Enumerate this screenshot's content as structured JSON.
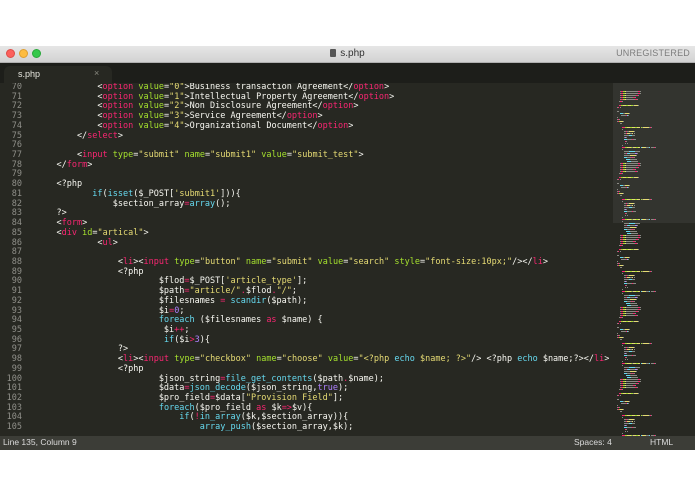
{
  "window": {
    "title": "s.php",
    "registration": "UNREGISTERED"
  },
  "tabs": [
    {
      "label": "s.php",
      "close_glyph": "×"
    }
  ],
  "line_numbers": [
    "70",
    "71",
    "72",
    "73",
    "74",
    "75",
    "76",
    "77",
    "78",
    "79",
    "80",
    "81",
    "82",
    "83",
    "84",
    "85",
    "86",
    "87",
    "88",
    "89",
    "90",
    "91",
    "92",
    "93",
    "94",
    "95",
    "96",
    "97",
    "98",
    "99",
    "100",
    "101",
    "102",
    "103",
    "104",
    "105"
  ],
  "code_lines": [
    [
      [
        "plain",
        "            <"
      ],
      [
        "tag",
        "option"
      ],
      [
        "plain",
        " "
      ],
      [
        "attr",
        "value"
      ],
      [
        "plain",
        "="
      ],
      [
        "str",
        "\"0\""
      ],
      [
        "plain",
        ">Business transaction Agreement</"
      ],
      [
        "tag",
        "option"
      ],
      [
        "plain",
        ">"
      ]
    ],
    [
      [
        "plain",
        "            <"
      ],
      [
        "tag",
        "option"
      ],
      [
        "plain",
        " "
      ],
      [
        "attr",
        "value"
      ],
      [
        "plain",
        "="
      ],
      [
        "str",
        "\"1\""
      ],
      [
        "plain",
        ">Intellectual Property Agreement</"
      ],
      [
        "tag",
        "option"
      ],
      [
        "plain",
        ">"
      ]
    ],
    [
      [
        "plain",
        "            <"
      ],
      [
        "tag",
        "option"
      ],
      [
        "plain",
        " "
      ],
      [
        "attr",
        "value"
      ],
      [
        "plain",
        "="
      ],
      [
        "str",
        "\"2\""
      ],
      [
        "plain",
        ">Non Disclosure Agreement</"
      ],
      [
        "tag",
        "option"
      ],
      [
        "plain",
        ">"
      ]
    ],
    [
      [
        "plain",
        "            <"
      ],
      [
        "tag",
        "option"
      ],
      [
        "plain",
        " "
      ],
      [
        "attr",
        "value"
      ],
      [
        "plain",
        "="
      ],
      [
        "str",
        "\"3\""
      ],
      [
        "plain",
        ">Service Agreement</"
      ],
      [
        "tag",
        "option"
      ],
      [
        "plain",
        ">"
      ]
    ],
    [
      [
        "plain",
        "            <"
      ],
      [
        "tag",
        "option"
      ],
      [
        "plain",
        " "
      ],
      [
        "attr",
        "value"
      ],
      [
        "plain",
        "="
      ],
      [
        "str",
        "\"4\""
      ],
      [
        "plain",
        ">Organizational Document</"
      ],
      [
        "tag",
        "option"
      ],
      [
        "plain",
        ">"
      ]
    ],
    [
      [
        "plain",
        "        </"
      ],
      [
        "tag",
        "select"
      ],
      [
        "plain",
        ">"
      ]
    ],
    [
      [
        "plain",
        ""
      ]
    ],
    [
      [
        "plain",
        "        <"
      ],
      [
        "tag",
        "input"
      ],
      [
        "plain",
        " "
      ],
      [
        "attr",
        "type"
      ],
      [
        "plain",
        "="
      ],
      [
        "str",
        "\"submit\""
      ],
      [
        "plain",
        " "
      ],
      [
        "attr",
        "name"
      ],
      [
        "plain",
        "="
      ],
      [
        "str",
        "\"submit1\""
      ],
      [
        "plain",
        " "
      ],
      [
        "attr",
        "value"
      ],
      [
        "plain",
        "="
      ],
      [
        "str",
        "\"submit_test\""
      ],
      [
        "plain",
        ">"
      ]
    ],
    [
      [
        "plain",
        "    </"
      ],
      [
        "tag",
        "form"
      ],
      [
        "plain",
        ">"
      ]
    ],
    [
      [
        "plain",
        ""
      ]
    ],
    [
      [
        "plain",
        "    <?php"
      ]
    ],
    [
      [
        "plain",
        "           "
      ],
      [
        "fn",
        "if"
      ],
      [
        "plain",
        "("
      ],
      [
        "fn",
        "isset"
      ],
      [
        "plain",
        "($_POST["
      ],
      [
        "str",
        "'submit1'"
      ],
      [
        "plain",
        "])){"
      ]
    ],
    [
      [
        "plain",
        "               $section_array"
      ],
      [
        "op",
        "="
      ],
      [
        "fn",
        "array"
      ],
      [
        "plain",
        "();"
      ]
    ],
    [
      [
        "plain",
        "    ?>"
      ]
    ],
    [
      [
        "plain",
        "    <"
      ],
      [
        "tag",
        "form"
      ],
      [
        "plain",
        ">"
      ]
    ],
    [
      [
        "plain",
        "    <"
      ],
      [
        "tag",
        "div"
      ],
      [
        "plain",
        " "
      ],
      [
        "attr",
        "id"
      ],
      [
        "plain",
        "="
      ],
      [
        "str",
        "\"artical\""
      ],
      [
        "plain",
        ">"
      ]
    ],
    [
      [
        "plain",
        "            <"
      ],
      [
        "tag",
        "ul"
      ],
      [
        "plain",
        ">"
      ]
    ],
    [
      [
        "plain",
        ""
      ]
    ],
    [
      [
        "plain",
        "                <"
      ],
      [
        "tag",
        "li"
      ],
      [
        "plain",
        "><"
      ],
      [
        "tag",
        "input"
      ],
      [
        "plain",
        " "
      ],
      [
        "attr",
        "type"
      ],
      [
        "plain",
        "="
      ],
      [
        "str",
        "\"button\""
      ],
      [
        "plain",
        " "
      ],
      [
        "attr",
        "name"
      ],
      [
        "plain",
        "="
      ],
      [
        "str",
        "\"submit\""
      ],
      [
        "plain",
        " "
      ],
      [
        "attr",
        "value"
      ],
      [
        "plain",
        "="
      ],
      [
        "str",
        "\"search\""
      ],
      [
        "plain",
        " "
      ],
      [
        "attr",
        "style"
      ],
      [
        "plain",
        "="
      ],
      [
        "str",
        "\"font-size:10px;\""
      ],
      [
        "plain",
        "/></"
      ],
      [
        "tag",
        "li"
      ],
      [
        "plain",
        ">"
      ]
    ],
    [
      [
        "plain",
        "                <?php"
      ]
    ],
    [
      [
        "plain",
        "                        $flod"
      ],
      [
        "op",
        "="
      ],
      [
        "plain",
        "$_POST["
      ],
      [
        "str",
        "'article_type'"
      ],
      [
        "plain",
        "];"
      ]
    ],
    [
      [
        "plain",
        "                        $path"
      ],
      [
        "op",
        "="
      ],
      [
        "str",
        "\"article/\""
      ],
      [
        "op",
        "."
      ],
      [
        "plain",
        "$flod"
      ],
      [
        "op",
        "."
      ],
      [
        "str",
        "\"/\""
      ],
      [
        "plain",
        ";"
      ]
    ],
    [
      [
        "plain",
        "                        $filesnames "
      ],
      [
        "op",
        "="
      ],
      [
        "plain",
        " "
      ],
      [
        "fn",
        "scandir"
      ],
      [
        "plain",
        "($path);"
      ]
    ],
    [
      [
        "plain",
        "                        $i"
      ],
      [
        "op",
        "="
      ],
      [
        "num",
        "0"
      ],
      [
        "plain",
        ";"
      ]
    ],
    [
      [
        "plain",
        "                        "
      ],
      [
        "fn",
        "foreach"
      ],
      [
        "plain",
        " ($filesnames "
      ],
      [
        "op",
        "as"
      ],
      [
        "plain",
        " $name) {"
      ]
    ],
    [
      [
        "plain",
        "                         $i"
      ],
      [
        "op",
        "++"
      ],
      [
        "plain",
        ";"
      ]
    ],
    [
      [
        "plain",
        "                         "
      ],
      [
        "fn",
        "if"
      ],
      [
        "plain",
        "($i"
      ],
      [
        "op",
        ">"
      ],
      [
        "num",
        "3"
      ],
      [
        "plain",
        "){"
      ]
    ],
    [
      [
        "plain",
        "                ?>"
      ]
    ],
    [
      [
        "plain",
        "                <"
      ],
      [
        "tag",
        "li"
      ],
      [
        "plain",
        "><"
      ],
      [
        "tag",
        "input"
      ],
      [
        "plain",
        " "
      ],
      [
        "attr",
        "type"
      ],
      [
        "plain",
        "="
      ],
      [
        "str",
        "\"checkbox\""
      ],
      [
        "plain",
        " "
      ],
      [
        "attr",
        "name"
      ],
      [
        "plain",
        "="
      ],
      [
        "str",
        "\"choose\""
      ],
      [
        "plain",
        " "
      ],
      [
        "attr",
        "value"
      ],
      [
        "plain",
        "="
      ],
      [
        "str",
        "\"<?php "
      ],
      [
        "fn",
        "echo"
      ],
      [
        "str",
        " $name; ?>\""
      ],
      [
        "plain",
        "/> <?php "
      ],
      [
        "fn",
        "echo"
      ],
      [
        "plain",
        " $name;?></"
      ],
      [
        "tag",
        "li"
      ],
      [
        "plain",
        ">"
      ]
    ],
    [
      [
        "plain",
        "                <?php"
      ]
    ],
    [
      [
        "plain",
        "                        $json_string"
      ],
      [
        "op",
        "="
      ],
      [
        "fn",
        "file_get_contents"
      ],
      [
        "plain",
        "($path"
      ],
      [
        "op",
        "."
      ],
      [
        "plain",
        "$name);"
      ]
    ],
    [
      [
        "plain",
        "                        $data"
      ],
      [
        "op",
        "="
      ],
      [
        "fn",
        "json_decode"
      ],
      [
        "plain",
        "($json_string,"
      ],
      [
        "num",
        "true"
      ],
      [
        "plain",
        ");"
      ]
    ],
    [
      [
        "plain",
        "                        $pro_field"
      ],
      [
        "op",
        "="
      ],
      [
        "plain",
        "$data["
      ],
      [
        "str",
        "\"Provision Field\""
      ],
      [
        "plain",
        "];"
      ]
    ],
    [
      [
        "plain",
        "                        "
      ],
      [
        "fn",
        "foreach"
      ],
      [
        "plain",
        "($pro_field "
      ],
      [
        "op",
        "as"
      ],
      [
        "plain",
        " $k"
      ],
      [
        "op",
        "=>"
      ],
      [
        "plain",
        "$v){"
      ]
    ],
    [
      [
        "plain",
        "                            "
      ],
      [
        "fn",
        "if"
      ],
      [
        "plain",
        "("
      ],
      [
        "op",
        "!"
      ],
      [
        "fn",
        "in_array"
      ],
      [
        "plain",
        "($k,$section_array)){"
      ]
    ],
    [
      [
        "plain",
        "                                "
      ],
      [
        "fn",
        "array_push"
      ],
      [
        "plain",
        "($section_array,$k);"
      ]
    ]
  ],
  "status": {
    "position": "Line 135, Column 9",
    "spaces": "Spaces: 4",
    "syntax": "HTML"
  },
  "colors": {
    "background": "#272822",
    "tag": "#f92672",
    "attribute": "#a6e22e",
    "string": "#e6db74",
    "function": "#66d9ef",
    "number": "#ae81ff"
  }
}
